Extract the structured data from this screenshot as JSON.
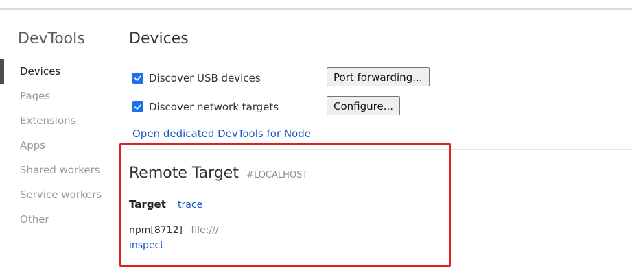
{
  "sidebar": {
    "title": "DevTools",
    "items": [
      {
        "label": "Devices",
        "active": true
      },
      {
        "label": "Pages",
        "active": false
      },
      {
        "label": "Extensions",
        "active": false
      },
      {
        "label": "Apps",
        "active": false
      },
      {
        "label": "Shared workers",
        "active": false
      },
      {
        "label": "Service workers",
        "active": false
      },
      {
        "label": "Other",
        "active": false
      }
    ]
  },
  "main": {
    "title": "Devices",
    "options": [
      {
        "label": "Discover USB devices",
        "checked": true,
        "button": "Port forwarding..."
      },
      {
        "label": "Discover network targets",
        "checked": true,
        "button": "Configure..."
      }
    ],
    "node_link": "Open dedicated DevTools for Node",
    "remote": {
      "title": "Remote Target",
      "host": "#LOCALHOST",
      "target_label": "Target",
      "trace_link": "trace",
      "process_name": "npm[8712]",
      "process_url": "file:///",
      "inspect_link": "inspect"
    }
  },
  "colors": {
    "accent": "#1a73e8",
    "link": "#1a5bc4",
    "highlight": "#e02020"
  }
}
